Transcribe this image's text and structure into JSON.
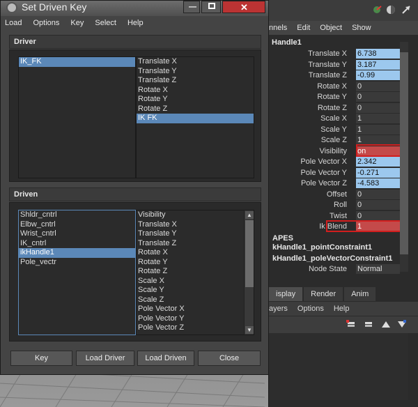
{
  "dialog": {
    "title": "Set Driven Key",
    "menu": [
      "Load",
      "Options",
      "Key",
      "Select",
      "Help"
    ],
    "driver": {
      "header": "Driver",
      "objects": [
        "IK_FK"
      ],
      "selected_object": "IK_FK",
      "attributes": [
        "Translate X",
        "Translate Y",
        "Translate Z",
        "Rotate X",
        "Rotate Y",
        "Rotate Z",
        "IK FK"
      ],
      "selected_attribute": "IK FK"
    },
    "driven": {
      "header": "Driven",
      "objects": [
        "Shldr_cntrl",
        "Elbw_cntrl",
        "Wrist_cntrl",
        "IK_cntrl",
        "ikHandle1",
        "Pole_vectr"
      ],
      "selected_object": "ikHandle1",
      "attributes": [
        "Visibility",
        "Translate X",
        "Translate Y",
        "Translate Z",
        "Rotate X",
        "Rotate Y",
        "Rotate Z",
        "Scale X",
        "Scale Y",
        "Scale Z",
        "Pole Vector X",
        "Pole Vector Y",
        "Pole Vector Z"
      ]
    },
    "buttons": {
      "key": "Key",
      "load_driver": "Load Driver",
      "load_driven": "Load Driven",
      "close": "Close"
    }
  },
  "channel_box": {
    "menu": [
      "nnels",
      "Edit",
      "Object",
      "Show"
    ],
    "object_name": "Handle1",
    "attributes": [
      {
        "label": "Translate X",
        "value": "6.738",
        "state": "keyed"
      },
      {
        "label": "Translate Y",
        "value": "3.187",
        "state": "keyed"
      },
      {
        "label": "Translate Z",
        "value": "-0.99",
        "state": "keyed"
      },
      {
        "label": "Rotate X",
        "value": "0",
        "state": "normal"
      },
      {
        "label": "Rotate Y",
        "value": "0",
        "state": "normal"
      },
      {
        "label": "Rotate Z",
        "value": "0",
        "state": "normal"
      },
      {
        "label": "Scale X",
        "value": "1",
        "state": "normal"
      },
      {
        "label": "Scale Y",
        "value": "1",
        "state": "normal"
      },
      {
        "label": "Scale Z",
        "value": "1",
        "state": "normal"
      },
      {
        "label": "Visibility",
        "value": "on",
        "state": "driven"
      },
      {
        "label": "Pole Vector X",
        "value": "2.342",
        "state": "keyed"
      },
      {
        "label": "Pole Vector Y",
        "value": "-0.271",
        "state": "keyed"
      },
      {
        "label": "Pole Vector Z",
        "value": "-4.583",
        "state": "keyed"
      },
      {
        "label": "Offset",
        "value": "0",
        "state": "normal"
      },
      {
        "label": "Roll",
        "value": "0",
        "state": "normal"
      },
      {
        "label": "Twist",
        "value": "0",
        "state": "normal"
      },
      {
        "label": "Ik Blend",
        "value": "1",
        "state": "driven"
      }
    ],
    "shapes_header": "APES",
    "shape_nodes": [
      "kHandle1_pointConstraint1",
      "kHandle1_poleVectorConstraint1"
    ],
    "node_state_label": "Node State",
    "node_state_value": "Normal",
    "tabs": [
      "isplay",
      "Render",
      "Anim"
    ],
    "layer_menu": [
      "ayers",
      "Options",
      "Help"
    ],
    "colors": {
      "keyed": "#9cc8ee",
      "driven": "#c44a4a",
      "selection": "#5b88b8"
    }
  }
}
